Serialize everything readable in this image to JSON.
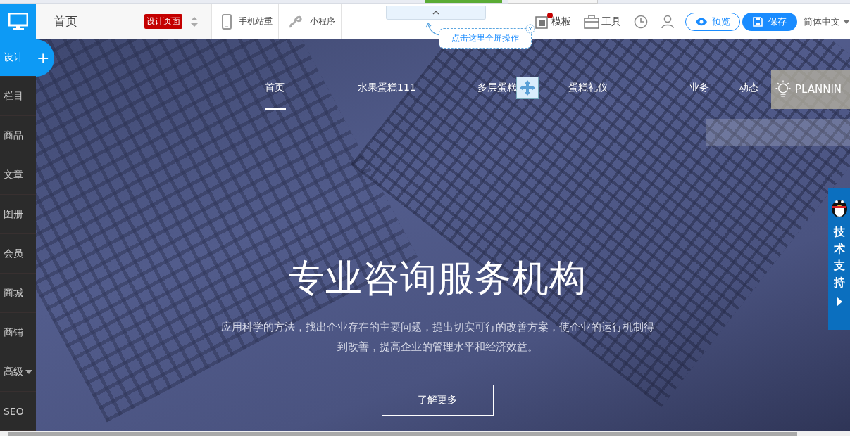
{
  "header": {
    "page_name": "首页",
    "page_badge": "设计页面",
    "views": [
      {
        "kind": "phone",
        "label": "手机站重"
      },
      {
        "kind": "miniapp",
        "label": "小程序"
      }
    ],
    "collapse_tip": "点击这里全屏操作",
    "tools": [
      {
        "kind": "template",
        "label": "模板",
        "notify": true
      },
      {
        "kind": "toolbox",
        "label": "工具",
        "notify": false
      },
      {
        "kind": "history",
        "notify": false
      },
      {
        "kind": "user",
        "notify": false
      }
    ],
    "preview": "预览",
    "save": "保存",
    "language": "简体中文"
  },
  "sidebar": {
    "add": "+",
    "items": [
      {
        "label": "设计",
        "selected": true,
        "dropdown": false
      },
      {
        "label": "栏目",
        "selected": false,
        "dropdown": false
      },
      {
        "label": "商品",
        "selected": false,
        "dropdown": false
      },
      {
        "label": "文章",
        "selected": false,
        "dropdown": false
      },
      {
        "label": "图册",
        "selected": false,
        "dropdown": false
      },
      {
        "label": "会员",
        "selected": false,
        "dropdown": false
      },
      {
        "label": "商城",
        "selected": false,
        "dropdown": false
      },
      {
        "label": "商铺",
        "selected": false,
        "dropdown": false
      },
      {
        "label": "高级",
        "selected": false,
        "dropdown": true
      },
      {
        "label": "SEO",
        "selected": false,
        "dropdown": false
      }
    ]
  },
  "site_nav": [
    {
      "label": "首页",
      "selected": true
    },
    {
      "label": "水果蛋糕111",
      "selected": false
    },
    {
      "label": "多层蛋糕",
      "selected": false
    },
    {
      "label": "蛋糕礼仪",
      "selected": false
    },
    {
      "label": "业务",
      "selected": false
    },
    {
      "label": "动态",
      "selected": false
    }
  ],
  "planning_banner": "PLANNIN",
  "hero": {
    "title": "专业咨询服务机构",
    "description": "应用科学的方法，找出企业存在的主要问题，提出切实可行的改善方案，使企业的运行机制得到改善，提高企业的管理水平和经济效益。",
    "button": "了解更多"
  },
  "support_tab": {
    "label": "技术支持"
  }
}
